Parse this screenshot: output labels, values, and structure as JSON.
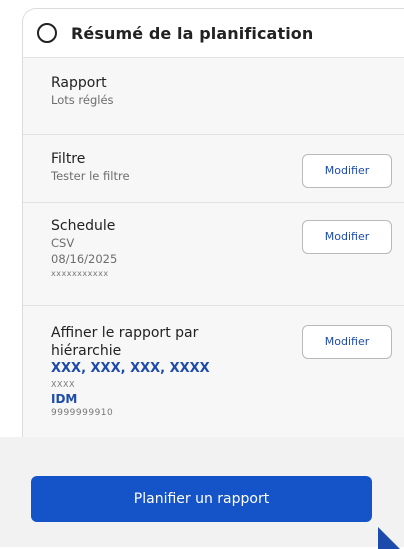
{
  "panel": {
    "title": "Résumé de la planification"
  },
  "sections": {
    "report": {
      "title": "Rapport",
      "lines": [
        "Lots réglés"
      ]
    },
    "filter": {
      "title": "Filtre",
      "lines": [
        "Tester le filtre"
      ],
      "edit_label": "Modifier"
    },
    "schedule": {
      "title": "Schedule",
      "format": "CSV",
      "date": "08/16/2025",
      "extra": "xxxxxxxxxxx",
      "edit_label": "Modifier"
    },
    "hierarchy": {
      "title_line1": "Affiner le rapport par",
      "title_line2": "hiérarchie",
      "values": "XXX, XXX, XXX, XXXX",
      "sub": "XXXX",
      "id_label": "IDM",
      "id_value": "9999999910",
      "edit_label": "Modifier"
    }
  },
  "footer": {
    "primary_label": "Planifier un rapport"
  },
  "colors": {
    "accent": "#1553c9",
    "link": "#1d4bab"
  }
}
